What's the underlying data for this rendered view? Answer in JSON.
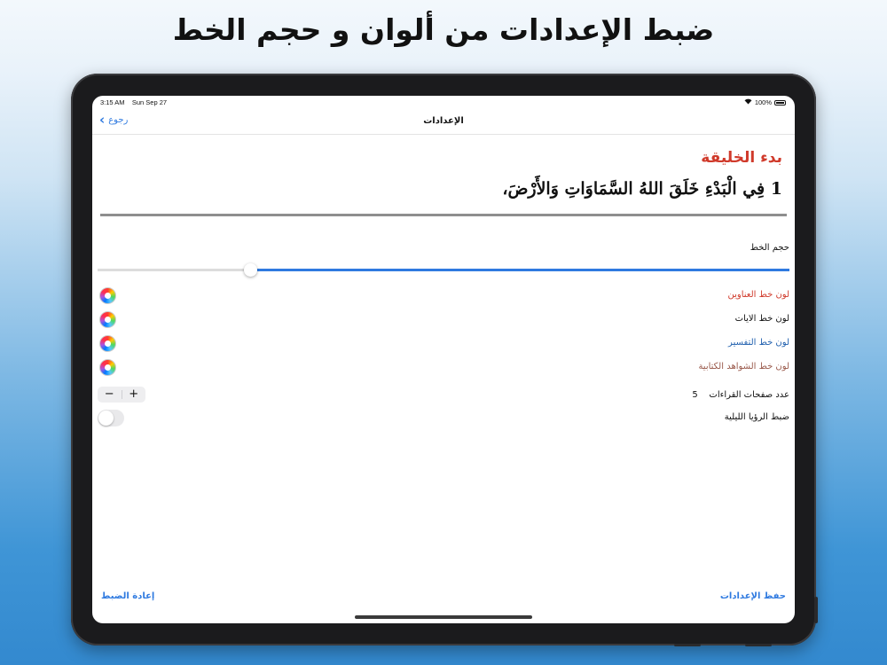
{
  "headline": "ضبط الإعدادات من ألوان و حجم الخط",
  "status_bar": {
    "time": "3:15 AM",
    "date": "Sun Sep 27",
    "wifi_icon": "wifi-icon",
    "battery": "100%"
  },
  "nav": {
    "back_label": "رجوع",
    "title": "الإعدادات"
  },
  "preview": {
    "heading": "بدء الخليقة",
    "verse": "1 فِي الْبَدْءِ خَلَقَ اللهُ السَّمَاوَاتِ وَالأَرْضَ،"
  },
  "font_size": {
    "label": "حجم الخط",
    "slider_value_fraction": 0.78
  },
  "color_settings": [
    {
      "label": "لون خط العناوين",
      "color": "#d03a2b"
    },
    {
      "label": "لون خط الايات",
      "color": "#111111"
    },
    {
      "label": "لون خط التفسير",
      "color": "#1f5fae"
    },
    {
      "label": "لون خط الشواهد الكتابية",
      "color": "#9a5a4c"
    }
  ],
  "reading_pages": {
    "label": "عدد صفحات القراءات",
    "value": "5",
    "minus": "−",
    "plus": "+"
  },
  "night_mode": {
    "label": "ضبط الرؤيا الليلية",
    "on": false
  },
  "footer": {
    "save_label": "حفظ الإعدادات",
    "reset_label": "إعادة الضبط"
  },
  "accent_color": "#2f7ae0"
}
